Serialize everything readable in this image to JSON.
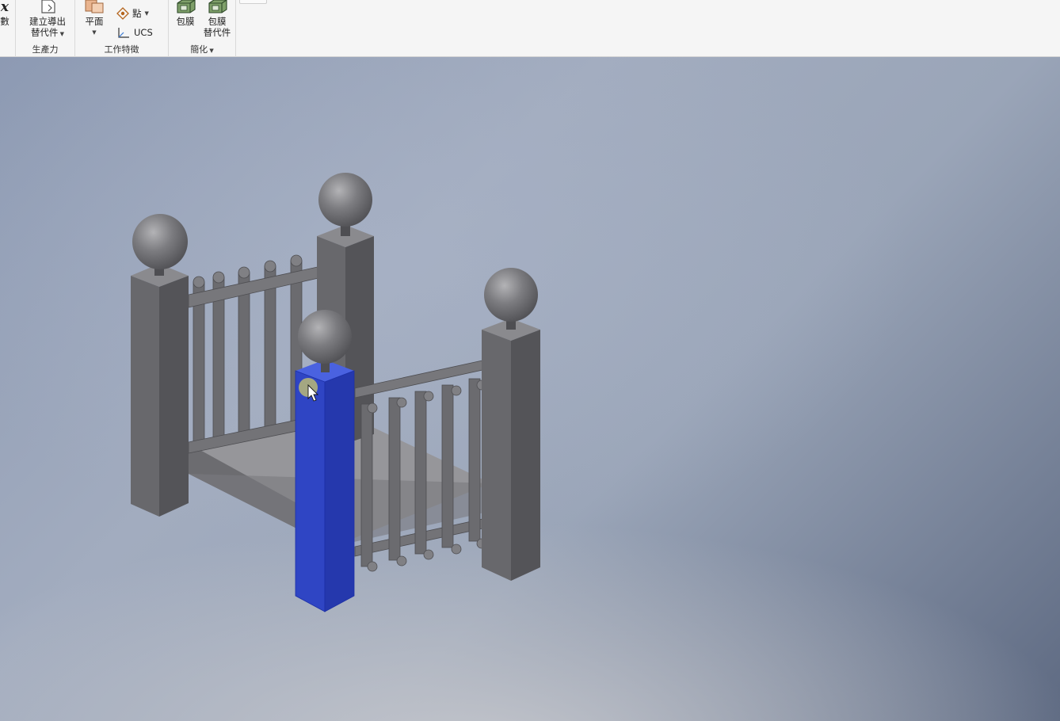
{
  "ribbon": {
    "param_partial": {
      "label": "數",
      "glyph": "x"
    },
    "create_derived": {
      "label_line1": "建立導出",
      "label_line2": "替代件"
    },
    "plane": {
      "label": "平面"
    },
    "point": {
      "label": "點"
    },
    "ucs": {
      "label": "UCS"
    },
    "shrinkwrap": {
      "label": "包膜"
    },
    "shrinkwrap_sub": {
      "label_line1": "包膜",
      "label_line2": "替代件"
    },
    "panels": {
      "productivity": "生產力",
      "work_features": "工作特徵",
      "simplify": "簡化"
    }
  },
  "viewport": {
    "selection_color": "#2f45c4",
    "model_color": "#6e6e72",
    "cursor": "arrow-cursor"
  }
}
